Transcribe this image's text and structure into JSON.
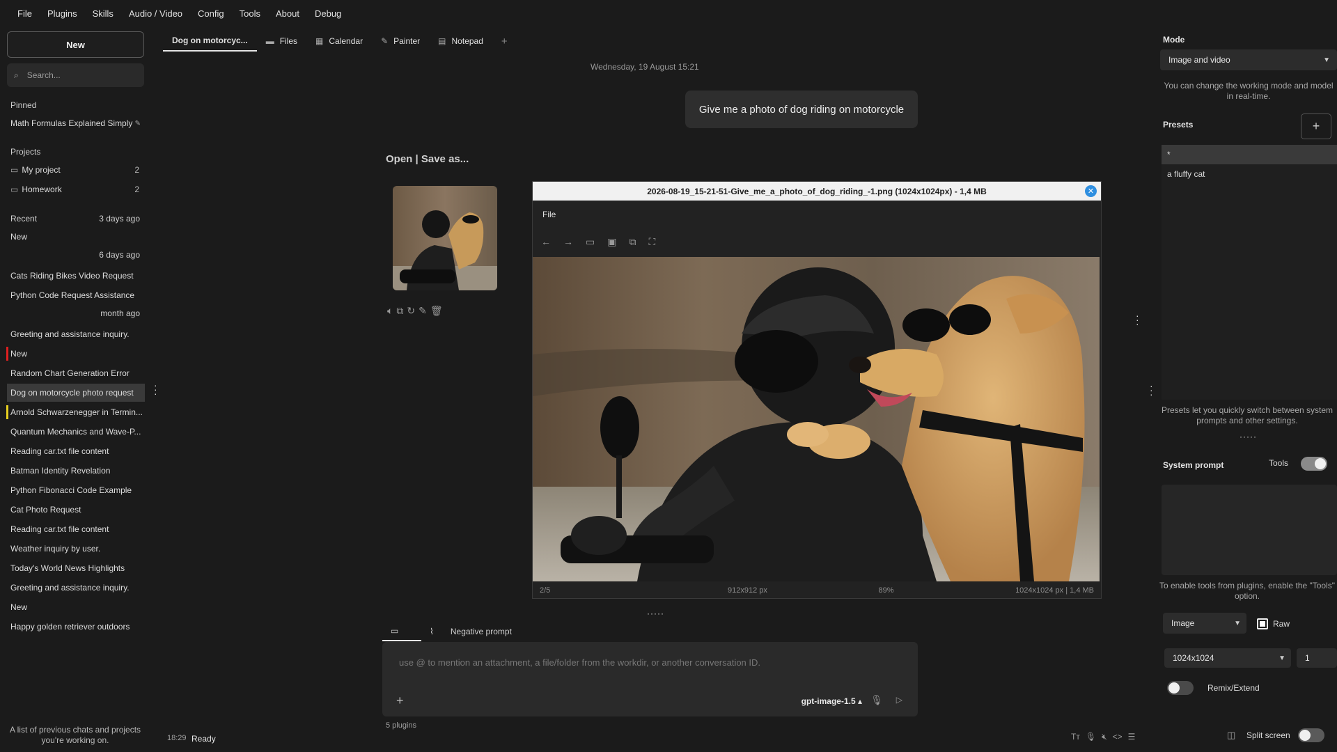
{
  "menu": [
    "File",
    "Plugins",
    "Skills",
    "Audio / Video",
    "Config",
    "Tools",
    "About",
    "Debug"
  ],
  "sidebar": {
    "new_label": "New",
    "search_placeholder": "Search...",
    "pinned_header": "Pinned",
    "pinned_item": "Math Formulas Explained Simply",
    "projects_header": "Projects",
    "projects": [
      {
        "label": "My project",
        "count": "2"
      },
      {
        "label": "Homework",
        "count": "2"
      }
    ],
    "recent_header": "Recent",
    "date_3days": "3 days ago",
    "date_6days": "6 days ago",
    "date_month": "month ago",
    "items": [
      "New",
      "Cats Riding Bikes Video Request",
      "Python Code Request Assistance",
      "Greeting and assistance inquiry.",
      "New",
      "Random Chart Generation Error",
      "Dog on motorcycle photo request",
      "Arnold Schwarzenegger in Termin...",
      "Quantum Mechanics and Wave-P...",
      "Reading car.txt file content",
      "Batman Identity Revelation",
      "Python Fibonacci Code Example",
      "Cat Photo Request",
      "Reading car.txt file content",
      "Weather inquiry by user.",
      "Today's World News Highlights",
      "Greeting and assistance inquiry.",
      "New",
      "Happy golden retriever outdoors"
    ],
    "footer": "A list of previous chats and projects you're working on."
  },
  "tabs": [
    "Dog on motorcyc...",
    "Files",
    "Calendar",
    "Painter",
    "Notepad",
    "+"
  ],
  "chat": {
    "date": "Wednesday, 19 August 15:21",
    "user_message": "Give me a photo of dog riding on motorcycle",
    "open_save": "Open | Save as..."
  },
  "viewer": {
    "title": "2026-08-19_15-21-51-Give_me_a_photo_of_dog_riding_-1.png (1024x1024px) - 1,4 MB",
    "file_menu": "File",
    "status": [
      "2/5",
      "912x912 px",
      "89%",
      "1024x1024 px | 1,4 MB"
    ]
  },
  "input": {
    "tab_negative": "Negative prompt",
    "placeholder": "use @ to mention an attachment, a file/folder from the workdir, or another conversation ID.",
    "model": "gpt-image-1.5 ▴",
    "plugins": "5 plugins"
  },
  "status": {
    "time": "18:29",
    "ready": "Ready"
  },
  "right": {
    "mode_header": "Mode",
    "mode_value": "Image and video",
    "mode_note": "You can change the working mode and model in real-time.",
    "presets_header": "Presets",
    "presets": [
      "*",
      "a fluffy cat"
    ],
    "presets_note": "Presets let you quickly switch between system prompts and other settings.",
    "sysprompt_header": "System prompt",
    "tools_label": "Tools",
    "tools_note": "To enable tools from plugins, enable the \"Tools\" option.",
    "image_select": "Image",
    "raw_label": "Raw",
    "size_select": "1024x1024",
    "count_value": "1",
    "remix_label": "Remix/Extend",
    "split_label": "Split screen"
  },
  "colors": {
    "accent_blue": "#2f8fe0",
    "marker_red": "#e02020",
    "marker_yellow": "#e8d020"
  }
}
